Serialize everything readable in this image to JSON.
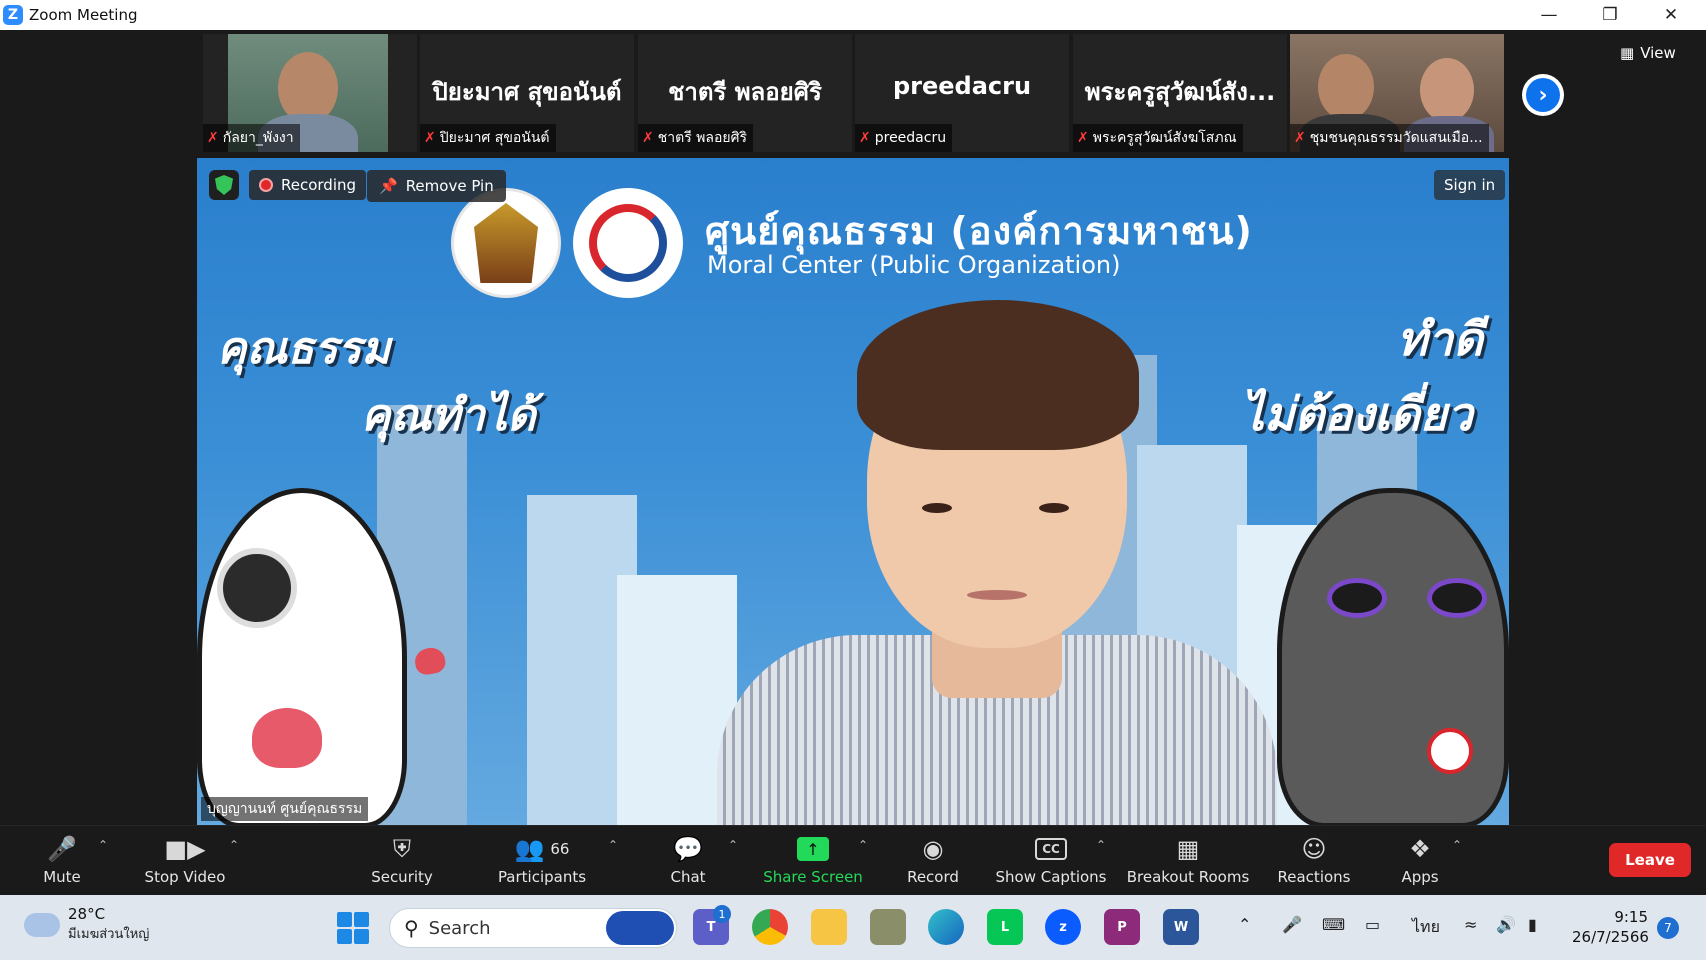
{
  "window": {
    "app_icon": "zoom-logo",
    "title": "Zoom Meeting",
    "controls": [
      "minimize",
      "restore",
      "close"
    ]
  },
  "gallery": {
    "participants": [
      {
        "display_name": "",
        "tag_name": "กัลยา_พังงา",
        "muted": true,
        "has_video": true
      },
      {
        "display_name": "ปิยะมาศ สุขอนันต์",
        "tag_name": "ปิยะมาศ สุขอนันต์",
        "muted": true,
        "has_video": false
      },
      {
        "display_name": "ชาตรี พลอยศิริ",
        "tag_name": "ชาตรี พลอยศิริ",
        "muted": true,
        "has_video": false
      },
      {
        "display_name": "preedacru",
        "tag_name": "preedacru",
        "muted": true,
        "has_video": false
      },
      {
        "display_name": "พระครูสุวัฒน์สัง...",
        "tag_name": "พระครูสุวัฒน์สังฆโสภณ",
        "muted": true,
        "has_video": false
      },
      {
        "display_name": "",
        "tag_name": "ชุมชนคุณธรรมวัดแสนเมือ...",
        "muted": true,
        "has_video": true
      }
    ],
    "next_icon": "chevron-right-icon",
    "view_label": "View"
  },
  "main_video": {
    "security_icon": "shield-check-icon",
    "recording_label": "Recording",
    "remove_pin_label": "Remove Pin",
    "sign_in_label": "Sign in",
    "speaker_name": "บุญญานนท์ ศูนย์คุณธรรม",
    "background": {
      "org_name_th": "ศูนย์คุณธรรม (องค์การมหาชน)",
      "org_name_en": "Moral Center (Public Organization)",
      "slogan_left_1": "คุณธรรม",
      "slogan_left_2": "คุณทำได้",
      "slogan_right_1": "ทำดี",
      "slogan_right_2": "ไม่ต้องเดี่ยว"
    }
  },
  "toolbar": {
    "mute": "Mute",
    "stop_video": "Stop Video",
    "security": "Security",
    "participants": "Participants",
    "participants_count": "66",
    "chat": "Chat",
    "share_screen": "Share Screen",
    "record": "Record",
    "show_captions": "Show Captions",
    "breakout_rooms": "Breakout Rooms",
    "reactions": "Reactions",
    "apps": "Apps",
    "leave": "Leave",
    "colors": {
      "share_green": "#23d959",
      "leave_red": "#e02828",
      "accent_blue": "#0e72ed"
    }
  },
  "taskbar": {
    "weather_temp": "28°C",
    "weather_desc": "มีเมฆส่วนใหญ่",
    "search_placeholder": "Search",
    "apps": [
      "teams-icon",
      "chrome-icon",
      "file-explorer-icon",
      "app-icon",
      "edge-icon",
      "line-icon",
      "zoom-icon",
      "pdf-icon",
      "word-icon"
    ],
    "chat_badge": "1",
    "language": "ไทย",
    "time": "9:15",
    "date": "26/7/2566",
    "notification_count": "7"
  }
}
